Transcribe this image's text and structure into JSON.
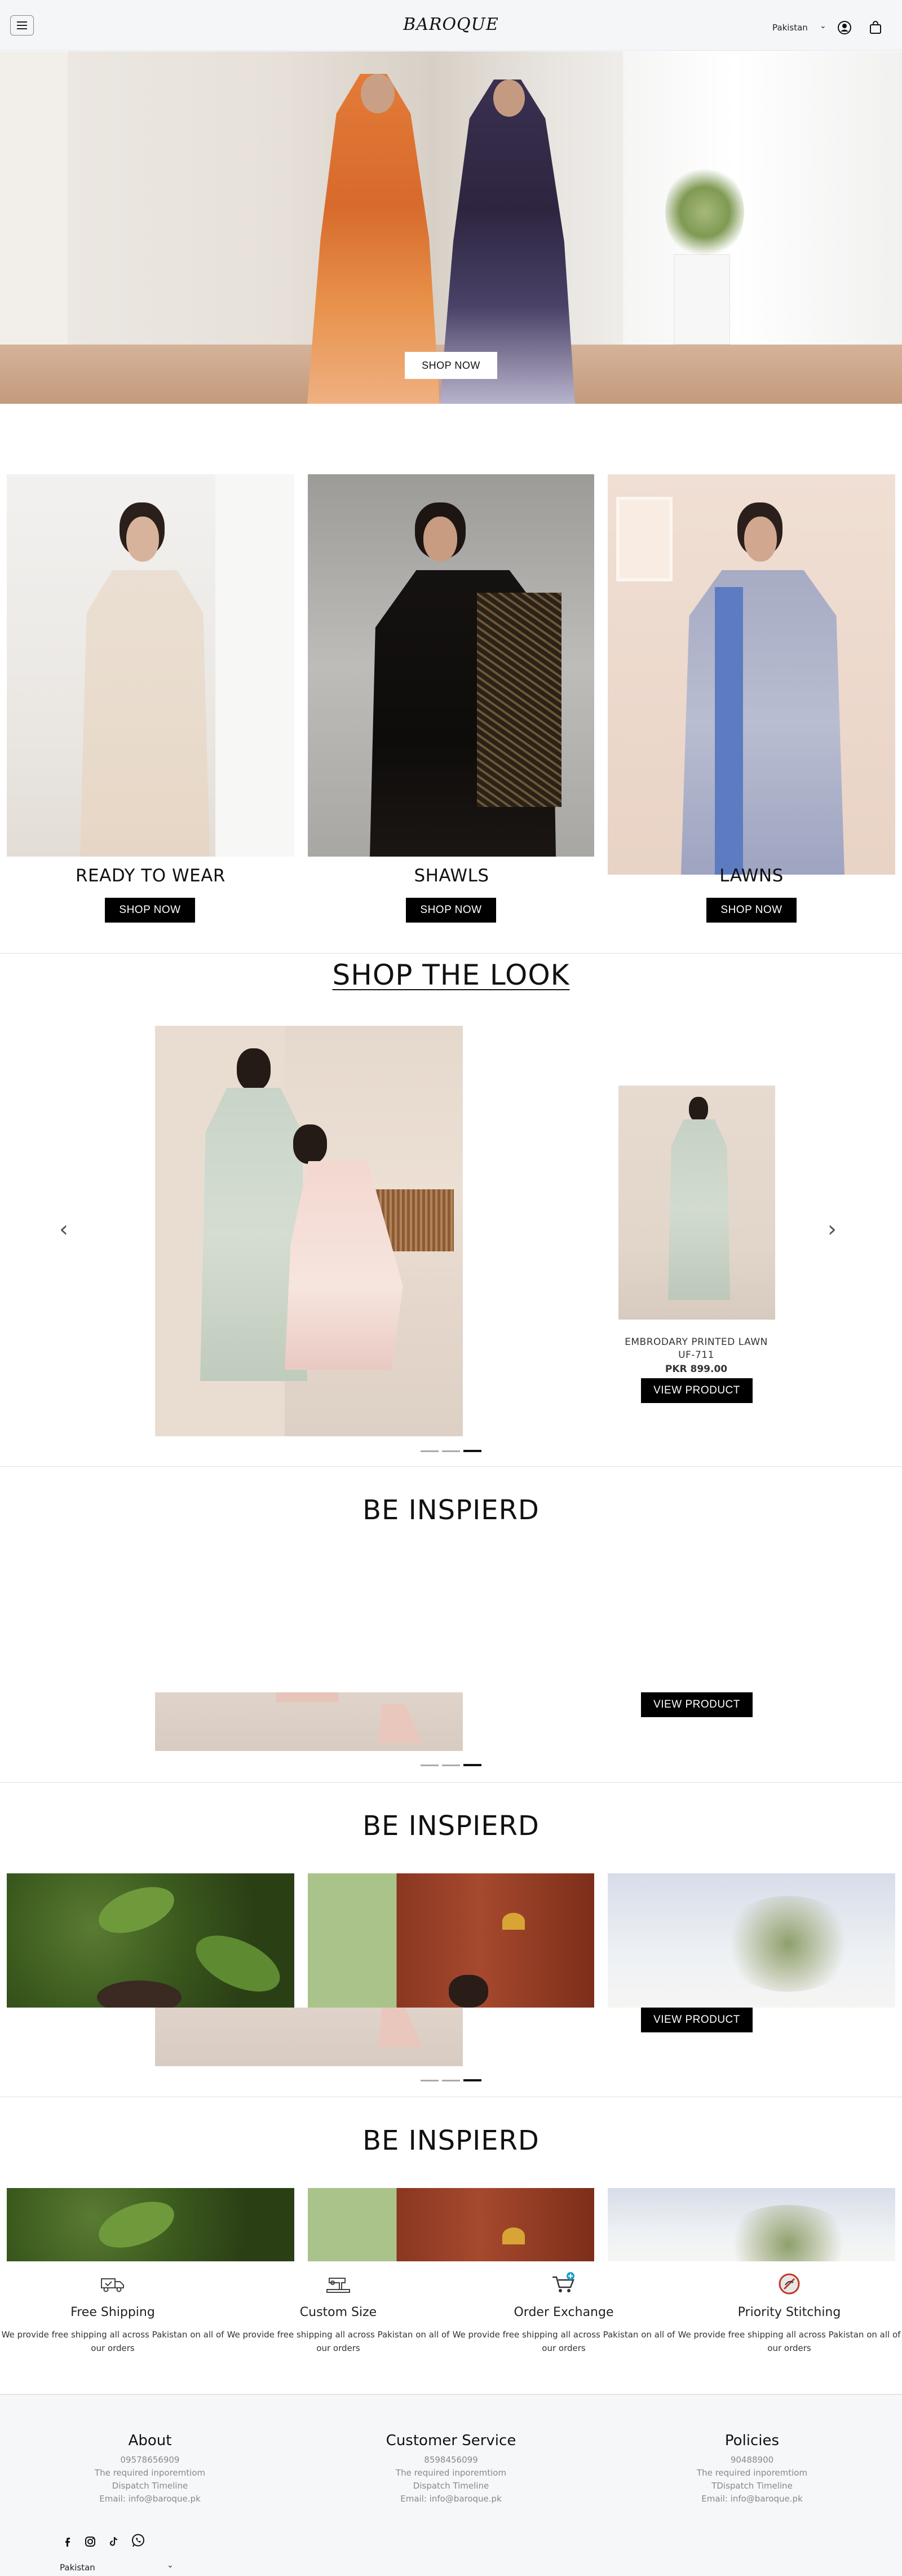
{
  "header": {
    "brand": "BAROQUE",
    "country": "Pakistan",
    "icons": [
      "menu-icon",
      "user-icon",
      "bag-icon"
    ]
  },
  "hero": {
    "button_label": "SHOP NOW"
  },
  "categories": [
    {
      "label": "READY TO WEAR",
      "button_label": "SHOP NOW"
    },
    {
      "label": "SHAWLS",
      "button_label": "SHOP NOW"
    },
    {
      "label": "LAWNS",
      "button_label": "SHOP NOW"
    }
  ],
  "shop_the_look": {
    "title": "SHOP THE LOOK",
    "product": {
      "name_line1": "EMBRODARY PRINTED LAWN",
      "name_line2": "UF-711",
      "price": "PKR 899.00",
      "button_label": "VIEW PRODUCT"
    },
    "active_dot": 3,
    "dot_count": 3
  },
  "inspired_sections": [
    {
      "title": "BE INSPIERD",
      "button_label": "VIEW PRODUCT"
    },
    {
      "title": "BE INSPIERD",
      "button_label": "VIEW PRODUCT"
    },
    {
      "title": "BE INSPIERD"
    }
  ],
  "features": [
    {
      "title": "Free Shipping",
      "description": "We provide free shipping all across Pakistan on all of our orders",
      "icon": "truck-icon"
    },
    {
      "title": "Custom Size",
      "description": "We provide free shipping all across Pakistan on all of our orders",
      "icon": "sewing-machine-icon"
    },
    {
      "title": "Order Exchange",
      "description": "We provide free shipping all across Pakistan on all of our orders",
      "icon": "cart-icon"
    },
    {
      "title": "Priority Stitching",
      "description": "We provide free shipping all across Pakistan on all of our orders",
      "icon": "stitching-icon"
    }
  ],
  "footer": {
    "columns": [
      {
        "heading": "About",
        "lines": [
          "09578656909",
          "The required inporemtiom",
          "Dispatch Timeline",
          "Email: info@baroque.pk"
        ]
      },
      {
        "heading": "Customer Service",
        "lines": [
          "8598456099",
          "The required inporemtiom",
          "Dispatch Timeline",
          "Email: info@baroque.pk"
        ]
      },
      {
        "heading": "Policies",
        "lines": [
          "90488900",
          "The required inporemtiom",
          "TDispatch Timeline",
          "Email: info@baroque.pk"
        ]
      }
    ],
    "socials": [
      "facebook-icon",
      "instagram-icon",
      "tiktok-icon",
      "whatsapp-icon"
    ],
    "country": "Pakistan"
  },
  "colors": {
    "accent": "#000000",
    "background": "#ffffff",
    "header_bg": "#f4f6f8",
    "muted_text": "#888888"
  }
}
